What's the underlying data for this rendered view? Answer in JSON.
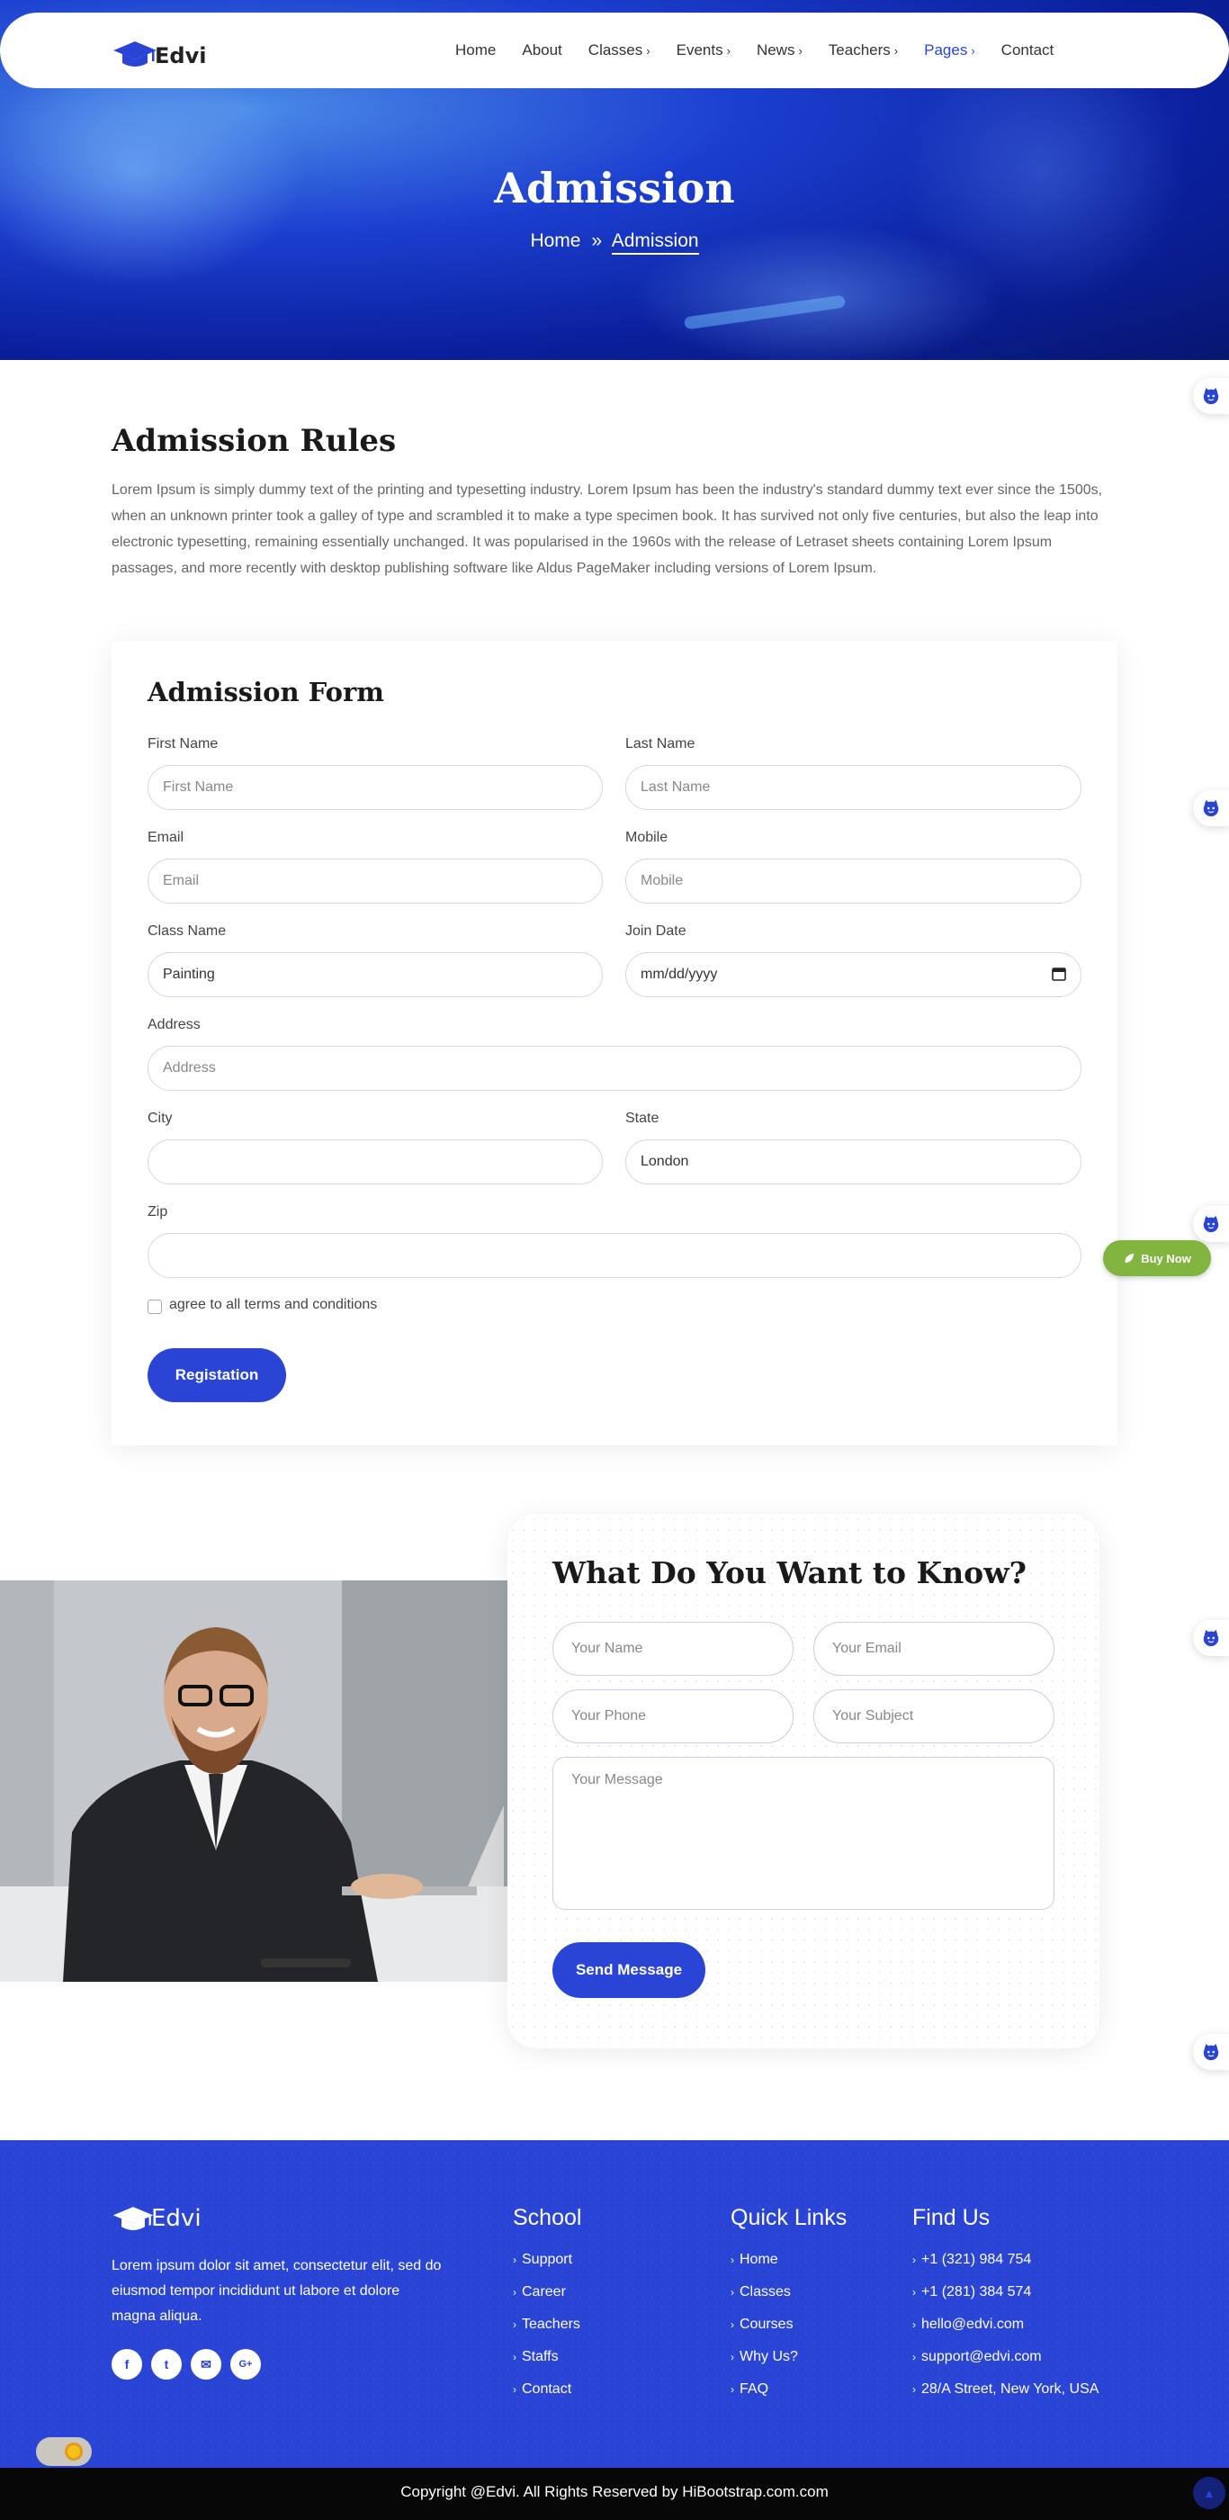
{
  "brand": {
    "name": "Edvi"
  },
  "nav": {
    "items": [
      {
        "label": "Home",
        "chevron": ""
      },
      {
        "label": "About",
        "chevron": ""
      },
      {
        "label": "Classes",
        "chevron": "›"
      },
      {
        "label": "Events",
        "chevron": "›"
      },
      {
        "label": "News",
        "chevron": "›"
      },
      {
        "label": "Teachers",
        "chevron": "›"
      },
      {
        "label": "Pages",
        "chevron": "›"
      },
      {
        "label": "Contact",
        "chevron": ""
      }
    ],
    "active": "Pages"
  },
  "hero": {
    "title": "Admission",
    "breadcrumb_home": "Home",
    "breadcrumb_sep": "»",
    "breadcrumb_current": "Admission"
  },
  "rules": {
    "title": "Admission Rules",
    "text": "Lorem Ipsum is simply dummy text of the printing and typesetting industry. Lorem Ipsum has been the industry's standard dummy text ever since the 1500s, when an unknown printer took a galley of type and scrambled it to make a type specimen book. It has survived not only five centuries, but also the leap into electronic typesetting, remaining essentially unchanged. It was popularised in the 1960s with the release of Letraset sheets containing Lorem Ipsum passages, and more recently with desktop publishing software like Aldus PageMaker including versions of Lorem Ipsum."
  },
  "form": {
    "title": "Admission Form",
    "first_name": {
      "label": "First Name",
      "placeholder": "First Name"
    },
    "last_name": {
      "label": "Last Name",
      "placeholder": "Last Name"
    },
    "email": {
      "label": "Email",
      "placeholder": "Email"
    },
    "mobile": {
      "label": "Mobile",
      "placeholder": "Mobile"
    },
    "class_name": {
      "label": "Class Name",
      "value": "Painting"
    },
    "join_date": {
      "label": "Join Date",
      "value": "mm/dd/yyyy"
    },
    "address": {
      "label": "Address",
      "placeholder": "Address"
    },
    "city": {
      "label": "City",
      "value": ""
    },
    "state": {
      "label": "State",
      "value": "London"
    },
    "zip": {
      "label": "Zip",
      "value": ""
    },
    "terms_label": "agree to all terms and conditions",
    "terms_checked": false,
    "submit_label": "Registation"
  },
  "buy_now": {
    "label": "Buy Now"
  },
  "contact": {
    "title": "What Do You Want to Know?",
    "name_placeholder": "Your Name",
    "email_placeholder": "Your Email",
    "phone_placeholder": "Your Phone",
    "subject_placeholder": "Your Subject",
    "message_placeholder": "Your Message",
    "submit_label": "Send Message"
  },
  "footer": {
    "about": "Lorem ipsum dolor sit amet, consectetur elit, sed do eiusmod tempor incididunt ut labore et dolore magna aliqua.",
    "social_icons": [
      "facebook-icon",
      "twitter-icon",
      "mail-icon",
      "google-plus-icon"
    ],
    "social": {
      "facebook": "f",
      "twitter": "t",
      "mail": "✉",
      "google": "G+"
    },
    "school": {
      "title": "School",
      "links": [
        "Support",
        "Career",
        "Teachers",
        "Staffs",
        "Contact"
      ]
    },
    "quick_links": {
      "title": "Quick Links",
      "links": [
        "Home",
        "Classes",
        "Courses",
        "Why Us?",
        "FAQ"
      ]
    },
    "find_us": {
      "title": "Find Us",
      "items": [
        "+1 (321) 984 754",
        "+1 (281) 384 574",
        "hello@edvi.com",
        "support@edvi.com",
        "28/A Street, New York, USA"
      ]
    },
    "copyright": "Copyright @Edvi. All Rights Reserved by HiBootstrap.com.com"
  },
  "colors": {
    "primary": "#2a45d6",
    "buy_now": "#82b440",
    "footer_bottom": "#070707"
  }
}
